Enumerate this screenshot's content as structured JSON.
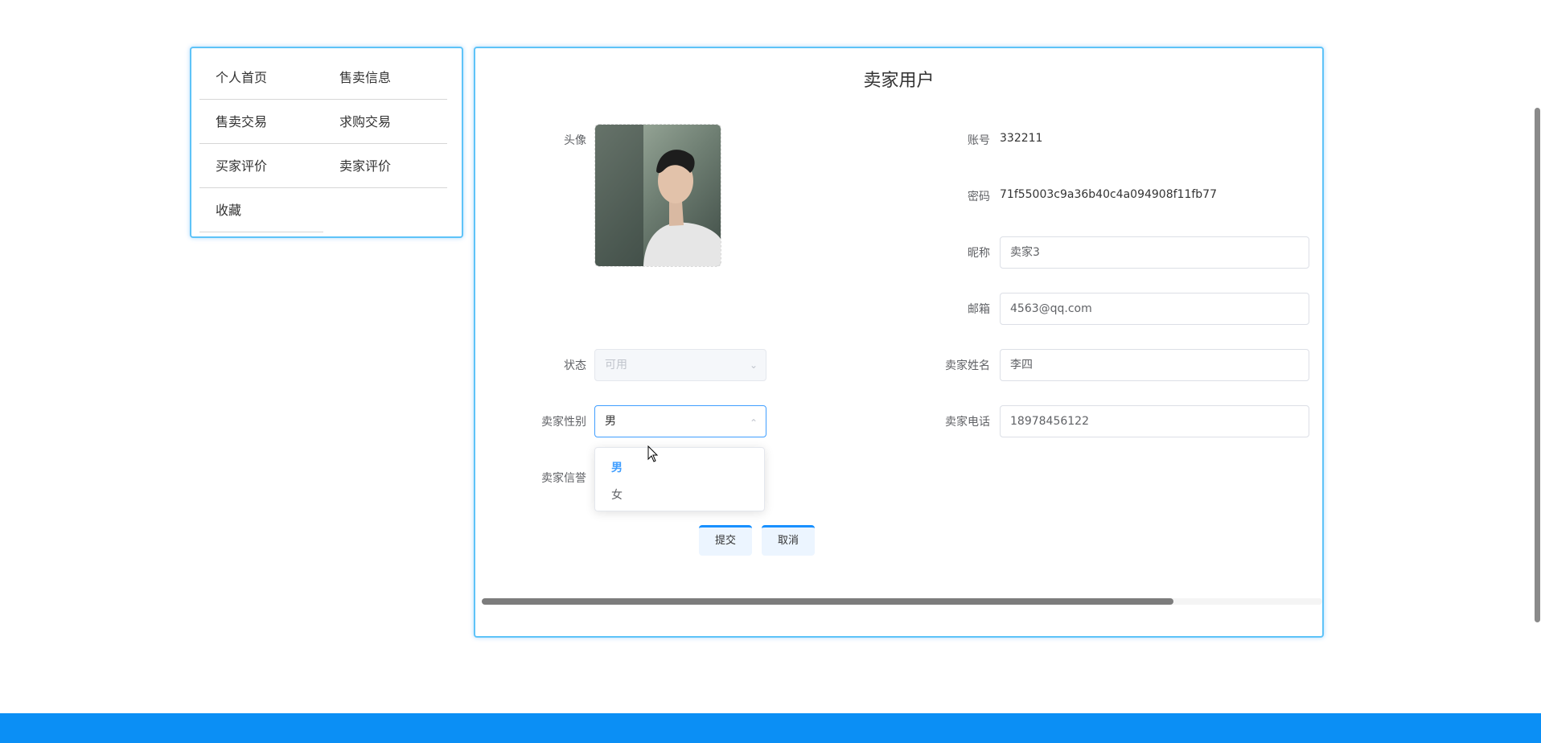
{
  "menu": {
    "items": [
      {
        "label": "个人首页"
      },
      {
        "label": "售卖信息"
      },
      {
        "label": "售卖交易"
      },
      {
        "label": "求购交易"
      },
      {
        "label": "买家评价"
      },
      {
        "label": "卖家评价"
      },
      {
        "label": "收藏"
      }
    ]
  },
  "form": {
    "title": "卖家用户",
    "avatar_label": "头像",
    "account_label": "账号",
    "account_value": "332211",
    "password_label": "密码",
    "password_value": "71f55003c9a36b40c4a094908f11fb77",
    "nickname_label": "昵称",
    "nickname_value": "卖家3",
    "email_label": "邮箱",
    "email_value": "4563@qq.com",
    "status_label": "状态",
    "status_value": "可用",
    "seller_name_label": "卖家姓名",
    "seller_name_value": "李四",
    "gender_label": "卖家性别",
    "gender_value": "男",
    "gender_options": [
      "男",
      "女"
    ],
    "phone_label": "卖家电话",
    "phone_value": "18978456122",
    "credit_label": "卖家信誉",
    "submit_label": "提交",
    "cancel_label": "取消"
  },
  "icons": {
    "chevron_down": "chevron-down-icon",
    "chevron_up": "chevron-up-icon",
    "cursor": "mouse-cursor-icon"
  },
  "colors": {
    "accent": "#409eff",
    "panel_border": "#5ec3f8",
    "footer": "#0b8ff5"
  }
}
